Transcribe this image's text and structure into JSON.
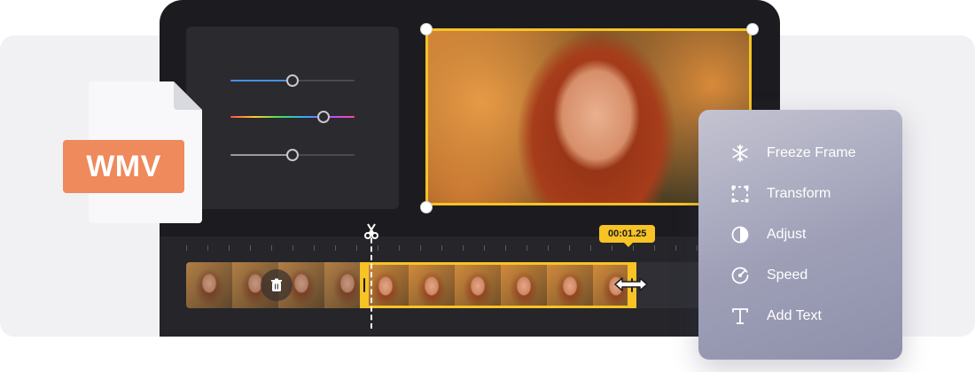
{
  "file_badge": {
    "label": "WMV"
  },
  "timeline": {
    "timecode": "00:01.25"
  },
  "adjustments": {
    "sliders": [
      {
        "name": "blue",
        "level": 0.5,
        "fill": "#4a90e2"
      },
      {
        "name": "hue",
        "level": 0.75,
        "fill": "linear-gradient(90deg,#ff4d4d,#ffcc33,#44dd66,#33aaff,#aa55ff,#ff44aa)"
      },
      {
        "name": "gray",
        "level": 0.5,
        "fill": "#9a9aa2"
      }
    ]
  },
  "context_menu": {
    "items": [
      {
        "label": "Freeze Frame",
        "icon": "snowflake-icon"
      },
      {
        "label": "Transform",
        "icon": "transform-icon"
      },
      {
        "label": "Adjust",
        "icon": "contrast-icon"
      },
      {
        "label": "Speed",
        "icon": "speed-icon"
      },
      {
        "label": "Add Text",
        "icon": "text-icon"
      }
    ]
  },
  "colors": {
    "accent": "#f7c325",
    "badge": "#ee8a5b",
    "editor_bg": "#1c1c20"
  }
}
